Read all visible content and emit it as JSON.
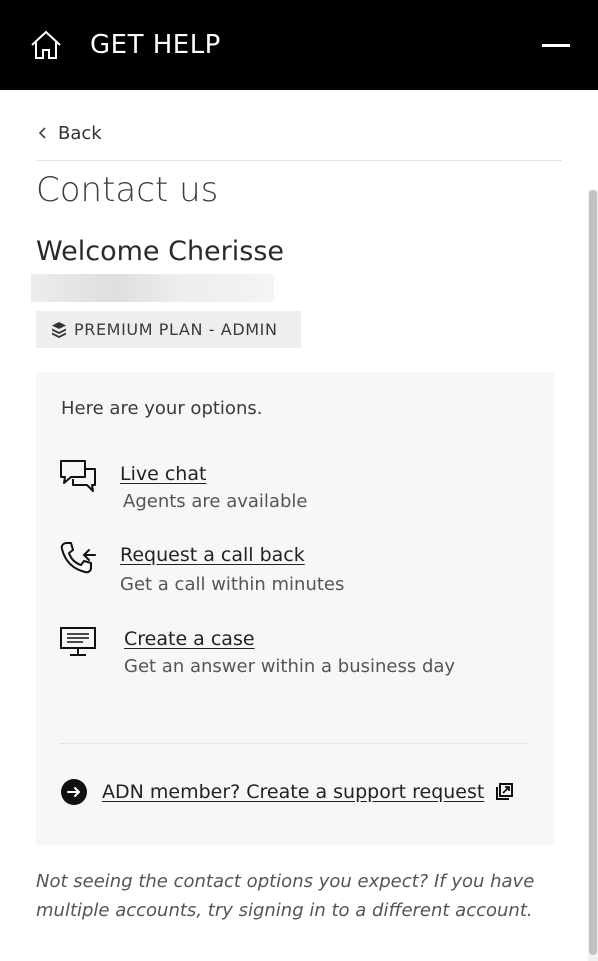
{
  "header": {
    "title": "GET HELP",
    "home_icon": "home-icon",
    "menu_icon": "hamburger-collapse-icon",
    "background": "#000000"
  },
  "nav": {
    "back_label": "Back"
  },
  "page": {
    "title": "Contact us",
    "welcome": "Welcome Cherisse"
  },
  "plan": {
    "label": "PREMIUM PLAN - ADMIN",
    "icon": "layers-icon"
  },
  "options": {
    "intro": "Here are your options.",
    "items": [
      {
        "icon": "chat-bubbles-icon",
        "label": "Live chat",
        "description": "Agents are available"
      },
      {
        "icon": "phone-callback-icon",
        "label": "Request a call back",
        "description": "Get a call within minutes"
      },
      {
        "icon": "monitor-case-icon",
        "label": "Create a case",
        "description": "Get an answer within a business day"
      }
    ],
    "adn": {
      "label": "ADN member? Create a support request",
      "icon": "arrow-circle-icon",
      "external_icon": "external-link-icon"
    }
  },
  "footer": {
    "note": "Not seeing the contact options you expect? If you have multiple accounts, try signing in to a different account."
  },
  "colors": {
    "panel": "#f7f7f7",
    "badge": "#eeeeee",
    "text": "#333333"
  }
}
